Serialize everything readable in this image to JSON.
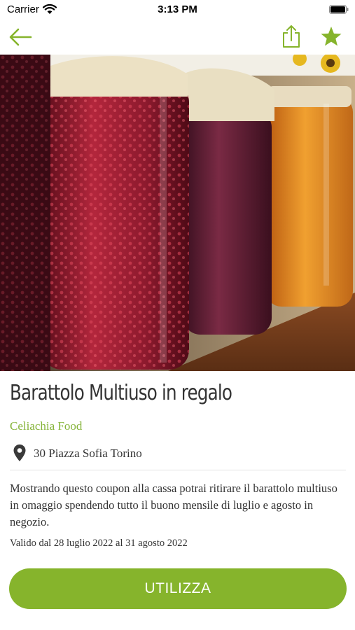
{
  "status_bar": {
    "carrier": "Carrier",
    "time": "3:13 PM"
  },
  "nav": {
    "back_icon": "arrow-left-icon",
    "share_icon": "share-icon",
    "favorite_icon": "star-icon"
  },
  "hero": {
    "subject": "jars of fruit jam"
  },
  "coupon": {
    "title": "Barattolo Multiuso in regalo",
    "merchant": "Celiachia Food",
    "address": "30 Piazza Sofia Torino",
    "description": "Mostrando questo coupon alla cassa potrai ritirare il barattolo multiuso in omaggio spendendo tutto il buono mensile di luglio e agosto in negozio.",
    "validity": "Valido dal 28 luglio 2022 al 31 agosto 2022"
  },
  "actions": {
    "use_label": "UTILIZZA"
  },
  "colors": {
    "accent": "#86b42c",
    "text": "#333333"
  }
}
